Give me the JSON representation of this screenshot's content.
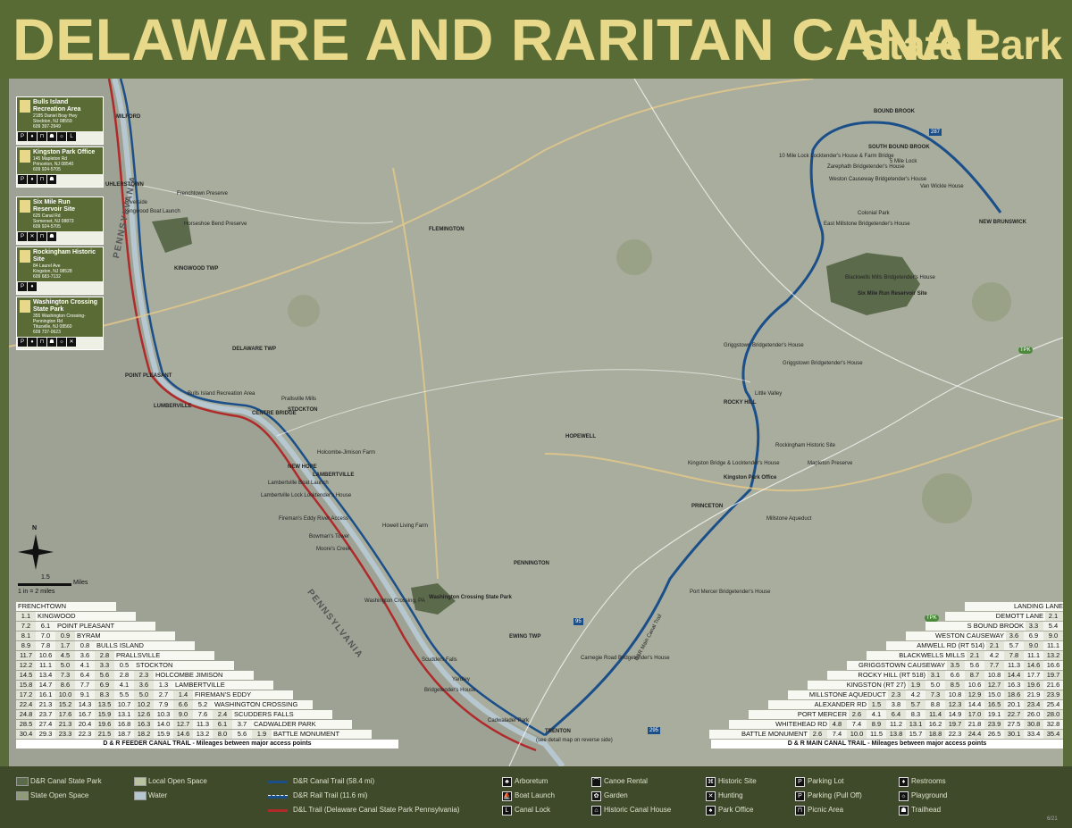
{
  "header": {
    "title": "DELAWARE AND RARITAN CANAL",
    "subtitle": "State Park"
  },
  "colors": {
    "header_bg": "#596b35",
    "title_text": "#e8d98a",
    "main_trail": "#1b4f8a",
    "feeder_trail": "#1b4f8a",
    "dl_trail": "#b02a2a",
    "state_park": "#5c6a4c",
    "open_space": "#8f9a78"
  },
  "sites": [
    {
      "name": "Bulls Island Recreation Area",
      "address": [
        "2185 Daniel Bray Hwy",
        "Stockton, NJ 08559",
        "609 397-2949"
      ],
      "icons": [
        "parking",
        "restrooms",
        "picnic",
        "trailhead",
        "playground",
        "canal-lock"
      ]
    },
    {
      "name": "Kingston Park Office",
      "address": [
        "145 Mapleton Rd",
        "Princeton, NJ 08540",
        "609 924-5705"
      ],
      "icons": [
        "parking",
        "restrooms",
        "picnic",
        "trailhead"
      ]
    },
    {
      "name": "Six Mile Run Reservoir Site",
      "address": [
        "625 Canal Rd",
        "Somerset, NJ 08873",
        "609 924-5705"
      ],
      "icons": [
        "parking",
        "hunting",
        "picnic",
        "trailhead"
      ]
    },
    {
      "name": "Rockingham Historic Site",
      "address": [
        "84 Laurel Ave",
        "Kingston, NJ 08528",
        "609 683-7132"
      ],
      "icons": [
        "parking",
        "restrooms"
      ]
    },
    {
      "name": "Washington Crossing State Park",
      "address": [
        "355 Washington Crossing-",
        "Pennington Rd",
        "Titusville, NJ 08560",
        "609 737-0623"
      ],
      "icons": [
        "parking",
        "restrooms",
        "picnic",
        "trailhead",
        "playground",
        "hunting"
      ]
    }
  ],
  "place_labels": {
    "milford": "MILFORD",
    "uhlerstown": "UHLERSTOWN",
    "frenchtown": "Frenchtown Preserve",
    "kingwood": "KINGWOOD TWP",
    "riverside": "Riverside",
    "kingwood_boat": "Kingwood Boat Launch",
    "horseshoe": "Horseshoe Bend Preserve",
    "delaware": "DELAWARE TWP",
    "point_pleasant": "POINT PLEASANT",
    "lumberville": "LUMBERVILLE",
    "bulls_island": "Bulls Island Recreation Area",
    "prallsville": "Prallsville Mills",
    "stockton": "STOCKTON",
    "centre_bridge": "CENTRE BRIDGE",
    "holcombe": "Holcombe-Jimison Farm",
    "new_hope": "NEW HOPE",
    "lambertville": "LAMBERTVILLE",
    "lambertville_boat": "Lambertville Boat Launch",
    "lambertville_lock": "Lambertville Lock Locktender's House",
    "firemans_eddy": "Fireman's Eddy River Access",
    "howell": "Howell Living Farm",
    "bowman": "Bowman's Tower",
    "moores": "Moore's Creek",
    "washington_crossing": "Washington Crossing State Park",
    "washington_crossing_pa": "Washington Crossing, PA",
    "scudders": "Scudders Falls",
    "yardley": "Yardley",
    "bridgetender": "Bridgetender's House",
    "cadwalader": "Cadwalader Park",
    "trenton": "TRENTON",
    "trenton_note": "(see detail map on reverse side)",
    "flemington": "FLEMINGTON",
    "hopewell": "HOPEWELL",
    "pennington": "PENNINGTON",
    "ewing": "EWING TWP",
    "princeton": "PRINCETON",
    "carnegie": "Carnegie Road Bridgetender's House",
    "port_mercer": "Port Mercer Bridgetender's House",
    "millstone_aq": "Millstone Aqueduct",
    "kingston_bridge": "Kingston Bridge & Locktender's House",
    "kingston_park": "Kingston Park Office",
    "mapleton": "Mapleton Preserve",
    "rockingham": "Rockingham Historic Site",
    "rocky_hill": "ROCKY HILL",
    "little_valley": "Little Valley",
    "griggstown_bridge": "Griggstown Bridgetender's House",
    "griggstown_bridge2": "Griggstown Bridgetender's House",
    "blackwells": "Blackwells Mills Bridgetender's House",
    "six_mile": "Six Mile Run Reservoir Site",
    "east_millstone": "East Millstone Bridgetender's House",
    "colonial": "Colonial Park",
    "weston": "Weston Causeway Bridgetender's House",
    "zarephath": "Zarephath Bridgetender's House",
    "ten_mile": "10 Mile Lock Locktender's House & Farm Bridge",
    "bound_brook": "BOUND BROOK",
    "south_bound": "SOUTH BOUND BROOK",
    "five_mile": "5 Mile Lock",
    "new_brunswick": "NEW BRUNSWICK",
    "van_wickle": "Van Wickle House",
    "pennsylvania1": "PENNSYLVANIA",
    "pennsylvania2": "PENNSYLVANIA",
    "trail_label": "D&R Main Canal Trail",
    "rt_tpk1": "TPK",
    "rt_tpk2": "TPK",
    "rt_287": "287",
    "rt_95": "95",
    "rt_295": "295"
  },
  "scale": {
    "north": "N",
    "distance": "1.5",
    "units": "Miles",
    "ratio": "1 in = 2 miles"
  },
  "feeder_table": {
    "footer": "D & R FEEDER CANAL TRAIL - Mileages between major access points",
    "stops": [
      {
        "name": "FRENCHTOWN",
        "values": []
      },
      {
        "name": "KINGWOOD",
        "values": [
          "1.1"
        ]
      },
      {
        "name": "POINT PLEASANT",
        "values": [
          "7.2",
          "6.1"
        ]
      },
      {
        "name": "BYRAM",
        "values": [
          "8.1",
          "7.0",
          "0.9"
        ]
      },
      {
        "name": "BULLS ISLAND",
        "values": [
          "8.9",
          "7.8",
          "1.7",
          "0.8"
        ]
      },
      {
        "name": "PRALLSVILLE",
        "values": [
          "11.7",
          "10.6",
          "4.5",
          "3.6",
          "2.8"
        ]
      },
      {
        "name": "STOCKTON",
        "values": [
          "12.2",
          "11.1",
          "5.0",
          "4.1",
          "3.3",
          "0.5"
        ]
      },
      {
        "name": "HOLCOMBE JIMISON",
        "values": [
          "14.5",
          "13.4",
          "7.3",
          "6.4",
          "5.6",
          "2.8",
          "2.3"
        ]
      },
      {
        "name": "LAMBERTVILLE",
        "values": [
          "15.8",
          "14.7",
          "8.6",
          "7.7",
          "6.9",
          "4.1",
          "3.6",
          "1.3"
        ]
      },
      {
        "name": "FIREMAN'S EDDY",
        "values": [
          "17.2",
          "16.1",
          "10.0",
          "9.1",
          "8.3",
          "5.5",
          "5.0",
          "2.7",
          "1.4"
        ]
      },
      {
        "name": "WASHINGTON CROSSING",
        "values": [
          "22.4",
          "21.3",
          "15.2",
          "14.3",
          "13.5",
          "10.7",
          "10.2",
          "7.9",
          "6.6",
          "5.2"
        ]
      },
      {
        "name": "SCUDDERS FALLS",
        "values": [
          "24.8",
          "23.7",
          "17.6",
          "16.7",
          "15.9",
          "13.1",
          "12.6",
          "10.3",
          "9.0",
          "7.6",
          "2.4"
        ]
      },
      {
        "name": "CADWALDER PARK",
        "values": [
          "28.5",
          "27.4",
          "21.3",
          "20.4",
          "19.6",
          "16.8",
          "16.3",
          "14.0",
          "12.7",
          "11.3",
          "6.1",
          "3.7"
        ]
      },
      {
        "name": "BATTLE MONUMENT",
        "values": [
          "30.4",
          "29.3",
          "23.3",
          "22.3",
          "21.5",
          "18.7",
          "18.2",
          "15.9",
          "14.6",
          "13.2",
          "8.0",
          "5.6",
          "1.9"
        ]
      }
    ]
  },
  "main_table": {
    "footer": "D & R MAIN CANAL TRAIL - Mileages between major access points",
    "stops": [
      {
        "name": "LANDING LANE",
        "values": []
      },
      {
        "name": "DEMOTT LANE",
        "values": [
          "2.1"
        ]
      },
      {
        "name": "S BOUND BROOK",
        "values": [
          "3.3",
          "5.4"
        ]
      },
      {
        "name": "WESTON CAUSEWAY",
        "values": [
          "3.6",
          "6.9",
          "9.0"
        ]
      },
      {
        "name": "AMWELL RD (RT 514)",
        "values": [
          "2.1",
          "5.7",
          "9.0",
          "11.1"
        ]
      },
      {
        "name": "BLACKWELLS MILLS",
        "values": [
          "2.1",
          "4.2",
          "7.8",
          "11.1",
          "13.2"
        ]
      },
      {
        "name": "GRIGGSTOWN CAUSEWAY",
        "values": [
          "3.5",
          "5.6",
          "7.7",
          "11.3",
          "14.6",
          "16.6"
        ]
      },
      {
        "name": "ROCKY HILL (RT 518)",
        "values": [
          "3.1",
          "6.6",
          "8.7",
          "10.8",
          "14.4",
          "17.7",
          "19.7"
        ]
      },
      {
        "name": "KINGSTON (RT 27)",
        "values": [
          "1.9",
          "5.0",
          "8.5",
          "10.6",
          "12.7",
          "16.3",
          "19.6",
          "21.6"
        ]
      },
      {
        "name": "MILLSTONE AQUEDUCT",
        "values": [
          "2.3",
          "4.2",
          "7.3",
          "10.8",
          "12.9",
          "15.0",
          "18.6",
          "21.9",
          "23.9"
        ]
      },
      {
        "name": "ALEXANDER RD",
        "values": [
          "1.5",
          "3.8",
          "5.7",
          "8.8",
          "12.3",
          "14.4",
          "16.5",
          "20.1",
          "23.4",
          "25.4"
        ]
      },
      {
        "name": "PORT MERCER",
        "values": [
          "2.6",
          "4.1",
          "6.4",
          "8.3",
          "11.4",
          "14.9",
          "17.0",
          "19.1",
          "22.7",
          "26.0",
          "28.0"
        ]
      },
      {
        "name": "WHITEHEAD RD",
        "values": [
          "4.8",
          "7.4",
          "8.9",
          "11.2",
          "13.1",
          "16.2",
          "19.7",
          "21.8",
          "23.9",
          "27.5",
          "30.8",
          "32.8"
        ]
      },
      {
        "name": "BATTLE MONUMENT",
        "values": [
          "2.6",
          "7.4",
          "10.0",
          "11.5",
          "13.8",
          "15.7",
          "18.8",
          "22.3",
          "24.4",
          "26.5",
          "30.1",
          "33.4",
          "35.4"
        ]
      }
    ]
  },
  "legend": {
    "canal_park": "D&R Canal State Park",
    "state_open": "State Open Space",
    "local_open": "Local Open Space",
    "water": "Water",
    "main_trail": "D&R Canal Trail (58.4 mi)",
    "rail_trail": "D&R Rail Trail (11.6 mi)",
    "dl_trail": "D&L Trail (Delaware Canal State Park Pennsylvania)",
    "arboretum": "Arboretum",
    "boat_launch": "Boat Launch",
    "canal_lock": "Canal Lock",
    "canoe_rental": "Canoe Rental",
    "garden": "Garden",
    "historic_canal_house": "Historic Canal House",
    "historic_site": "Historic Site",
    "hunting": "Hunting",
    "park_office": "Park Office",
    "parking_lot": "Parking Lot",
    "parking_pull_off": "Parking (Pull Off)",
    "picnic_area": "Picnic Area",
    "restrooms": "Restrooms",
    "playground": "Playground",
    "trailhead": "Trailhead",
    "date": "6/21"
  }
}
